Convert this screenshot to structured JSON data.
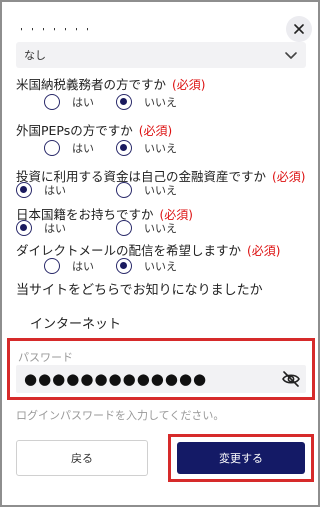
{
  "close_button": {
    "icon": "close-icon"
  },
  "cut_off_text": "〒〒〒〒〒〒〒",
  "select_field": {
    "value": "なし",
    "icon": "chevron-down-icon"
  },
  "questions": [
    {
      "label": "米国納税義務者の方ですか",
      "required": "(必須)",
      "options": [
        "はい",
        "いいえ"
      ],
      "selected": "いいえ"
    },
    {
      "label": "外国PEPsの方ですか",
      "required": "(必須)",
      "options": [
        "はい",
        "いいえ"
      ],
      "selected": "いいえ"
    },
    {
      "label": "投資に利用する資金は自己の金融資産ですか",
      "required": "(必須)",
      "options": [
        "はい",
        "いいえ"
      ],
      "selected": "はい"
    },
    {
      "label": "日本国籍をお持ちですか",
      "required": "(必須)",
      "options": [
        "はい",
        "いいえ"
      ],
      "selected": "はい"
    },
    {
      "label": "ダイレクトメールの配信を希望しますか",
      "required": "(必須)",
      "options": [
        "はい",
        "いいえ"
      ],
      "selected": "いいえ"
    }
  ],
  "source_question": {
    "label": "当サイトをどちらでお知りになりましたか",
    "value": "インターネット"
  },
  "password": {
    "label": "パスワード",
    "value": "●●●●●●●●●●●●●",
    "icon": "eye-off-icon"
  },
  "hint": "ログインパスワードを入力してください。",
  "buttons": {
    "back": "戻る",
    "submit": "変更する"
  },
  "colors": {
    "accent": "#141a66",
    "required": "#dd1111",
    "highlight": "#d62a2a"
  }
}
